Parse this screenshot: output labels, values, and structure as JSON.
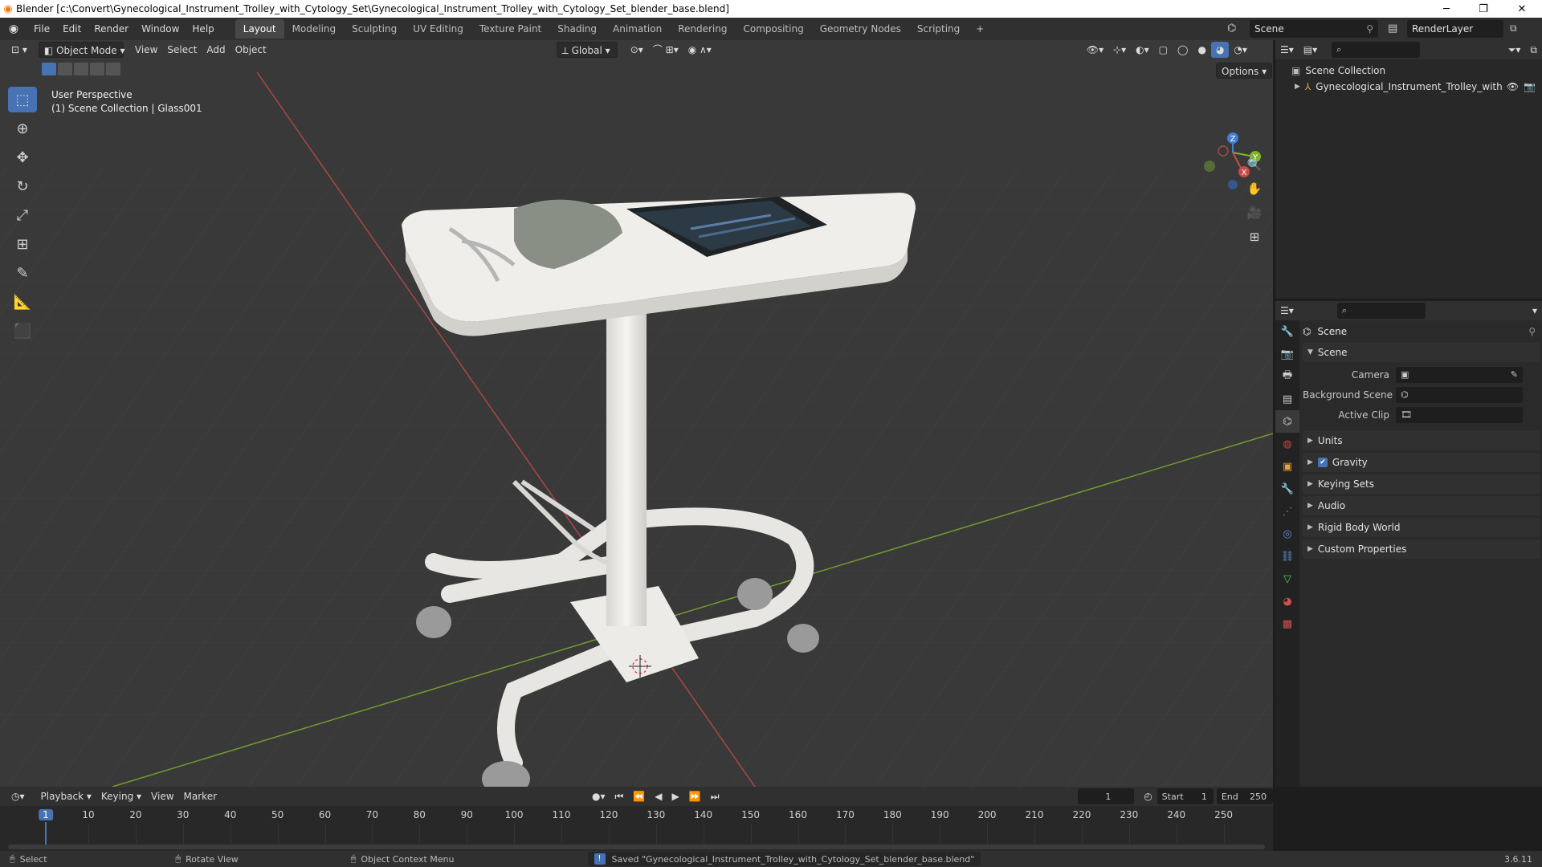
{
  "titlebar": {
    "title": "Blender [c:\\Convert\\Gynecological_Instrument_Trolley_with_Cytology_Set\\Gynecological_Instrument_Trolley_with_Cytology_Set_blender_base.blend]",
    "minimize": "─",
    "maximize": "❐",
    "close": "✕"
  },
  "menubar": {
    "menus": [
      "File",
      "Edit",
      "Render",
      "Window",
      "Help"
    ],
    "workspaces": [
      "Layout",
      "Modeling",
      "Sculpting",
      "UV Editing",
      "Texture Paint",
      "Shading",
      "Animation",
      "Rendering",
      "Compositing",
      "Geometry Nodes",
      "Scripting"
    ],
    "active_workspace": "Layout",
    "add_tab": "+",
    "scene_name": "Scene",
    "view_layer": "RenderLayer"
  },
  "viewport": {
    "mode": "Object Mode",
    "menus": [
      "View",
      "Select",
      "Add",
      "Object"
    ],
    "transform_orientation": "Global",
    "options_label": "Options",
    "perspective_label": "User Perspective",
    "collection_label": "(1) Scene Collection | Glass001",
    "axes": {
      "x": "X",
      "y": "Y",
      "z": "Z"
    }
  },
  "outliner": {
    "root": "Scene Collection",
    "items": [
      {
        "label": "Gynecological_Instrument_Trolley_with"
      }
    ]
  },
  "properties": {
    "context_title": "Scene",
    "scene_panel": {
      "title": "Scene",
      "fields": [
        {
          "label": "Camera",
          "value": ""
        },
        {
          "label": "Background Scene",
          "value": ""
        },
        {
          "label": "Active Clip",
          "value": ""
        }
      ]
    },
    "panels": [
      "Units",
      "Gravity",
      "Keying Sets",
      "Audio",
      "Rigid Body World",
      "Custom Properties"
    ],
    "gravity_checked": true
  },
  "timeline": {
    "menus": [
      "Playback",
      "Keying",
      "View",
      "Marker"
    ],
    "current_frame": "1",
    "start_label": "Start",
    "start": "1",
    "end_label": "End",
    "end": "250",
    "ticks": [
      "1",
      "10",
      "20",
      "30",
      "40",
      "50",
      "60",
      "70",
      "80",
      "90",
      "100",
      "110",
      "120",
      "130",
      "140",
      "150",
      "160",
      "170",
      "180",
      "190",
      "200",
      "210",
      "220",
      "230",
      "240",
      "250"
    ]
  },
  "statusbar": {
    "select": "Select",
    "rotate": "Rotate View",
    "context_menu": "Object Context Menu",
    "message": "Saved \"Gynecological_Instrument_Trolley_with_Cytology_Set_blender_base.blend\"",
    "version": "3.6.11"
  },
  "colors": {
    "accent": "#4772b3",
    "x_axis": "#c94a4a",
    "y_axis": "#82b32d",
    "z_axis": "#3f7fd6",
    "current_frame": "#4772b3"
  }
}
